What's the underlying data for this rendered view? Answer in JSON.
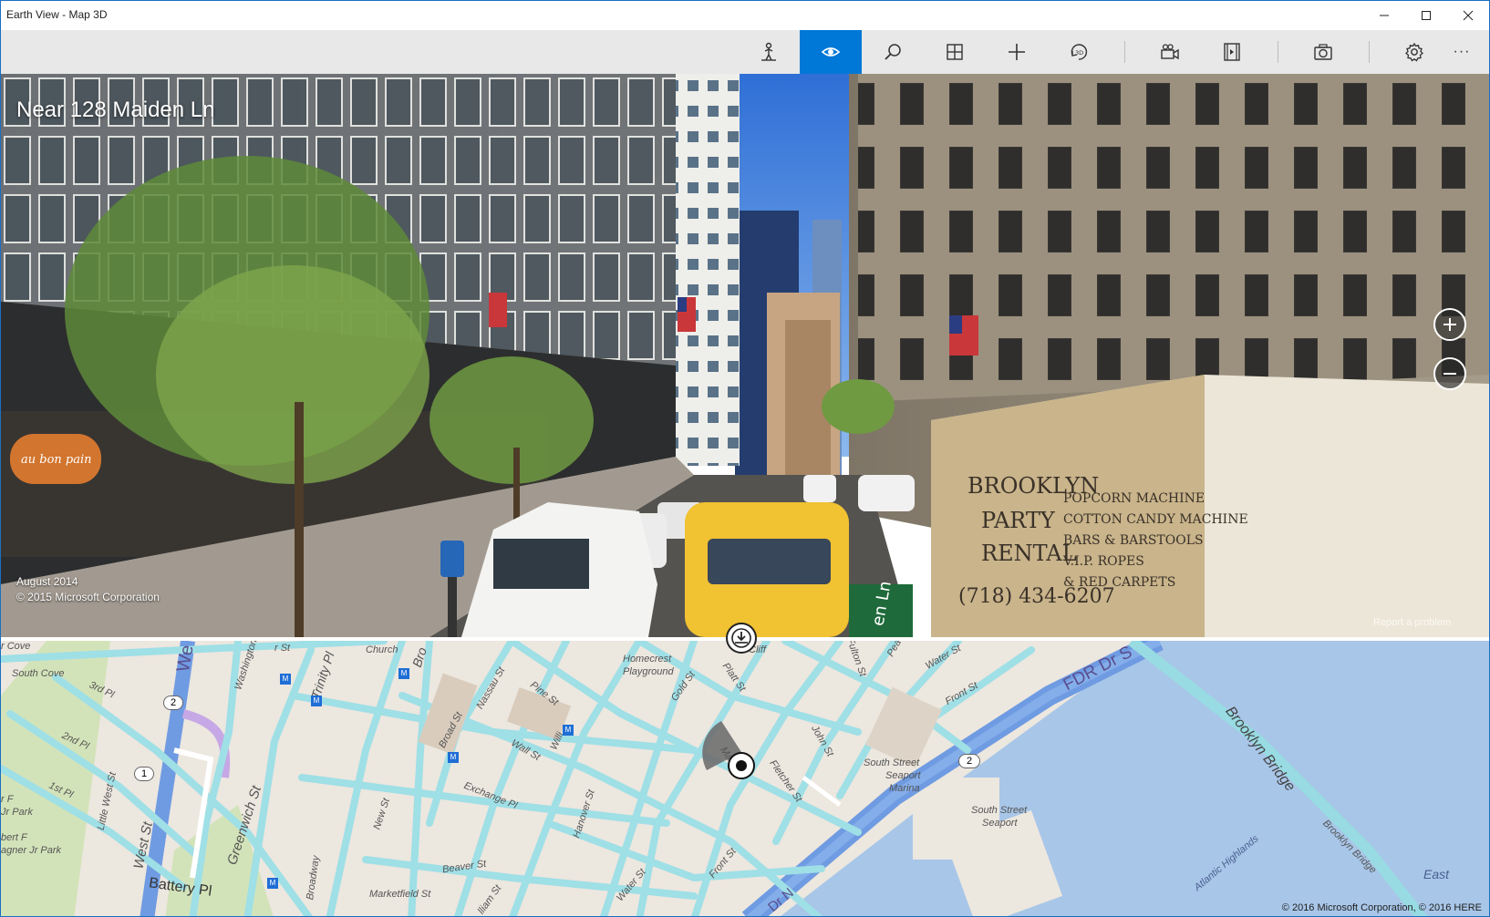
{
  "window": {
    "title": "Earth View - Map 3D"
  },
  "toolbar": {
    "items": [
      {
        "name": "streetside",
        "icon": "person-pin-icon"
      },
      {
        "name": "eye",
        "icon": "eye-icon",
        "active": true
      },
      {
        "name": "search",
        "icon": "search-icon"
      },
      {
        "name": "grid",
        "icon": "grid-icon"
      },
      {
        "name": "add",
        "icon": "plus-icon"
      },
      {
        "name": "rotate-3d",
        "icon": "rotate-3d-icon",
        "label": "3D"
      },
      {
        "name": "camera-tour",
        "icon": "video-camera-icon"
      },
      {
        "name": "film",
        "icon": "film-icon"
      },
      {
        "name": "screenshot",
        "icon": "camera-icon"
      },
      {
        "name": "settings",
        "icon": "gear-icon"
      },
      {
        "name": "more",
        "icon": "more-icon",
        "label": "···"
      }
    ],
    "accent": "#0078d7"
  },
  "streetside": {
    "location_title": "Near 128 Maiden Ln",
    "capture_date": "August 2014",
    "copyright": "© 2015 Microsoft Corporation",
    "report": "Report a problem",
    "shop_sign": "au bon pain",
    "truck": {
      "brand_line1": "BROOKLYN",
      "brand_line2": "PARTY",
      "brand_line3": "RENTAL",
      "phone": "(718) 434-6207",
      "services": [
        "POPCORN MACHINE",
        "COTTON CANDY MACHINE",
        "BARS & BARSTOOLS",
        "V.I.P. ROPES",
        "& RED CARPETS"
      ]
    },
    "street_sign": "en Ln"
  },
  "map": {
    "labels": {
      "church": "Church",
      "homecrest": "Homecrest",
      "playground": "Playground",
      "south_cove": "South Cove",
      "third_pl": "3rd Pl",
      "second_pl": "2nd Pl",
      "first_pl": "1st Pl",
      "washington": "Washington",
      "trinity": "Trinity Pl",
      "broadway_top": "Bro",
      "nassau": "Nassau St",
      "pine": "Pine St",
      "platt": "Platt St",
      "gold": "Gold St",
      "fulton": "Fulton St",
      "pearl": "Pea",
      "water_top": "Water St",
      "front_top": "Front St",
      "fdr": "FDR Dr S",
      "brooklyn_bridge": "Brooklyn Bridge",
      "brooklyn_bridge2": "Brooklyn Bridge",
      "broad": "Broad St",
      "wall": "Wall St",
      "william": "Willi",
      "exchange": "Exchange Pl",
      "new_st": "New St",
      "hanover": "Hanover St",
      "john": "John St",
      "fletcher": "Fletcher St",
      "maiden": "Ma",
      "seaport_marina1": "South Street",
      "seaport_marina2": "Seaport",
      "seaport_marina3": "Marina",
      "ssp1": "South Street",
      "ssp2": "Seaport",
      "little_west": "Little West St",
      "west_st": "West St",
      "greenwich": "Greenwich St",
      "battery": "Battery Pl",
      "broadway_bottom": "Broadway",
      "marketfield": "Marketfield St",
      "beaver": "Beaver St",
      "water_bottom": "Water St",
      "front_bottom": "Front St",
      "william_bottom": "lliam St",
      "east": "East",
      "atlantic": "Atlantic Highlands",
      "west_top": "We",
      "rpark1": "r F",
      "rpark2": "Jr Park",
      "rpark3": "bert F",
      "rpark4": "agner Jr Park",
      "dr_n": "Dr N",
      "ston": "r St",
      "con": "r Cove",
      "cliff": "Cliff"
    },
    "route_badges": [
      "2",
      "1",
      "2"
    ],
    "transit_icon": "metro-icon",
    "copyright": "© 2016 Microsoft Corporation, © 2016 HERE"
  }
}
